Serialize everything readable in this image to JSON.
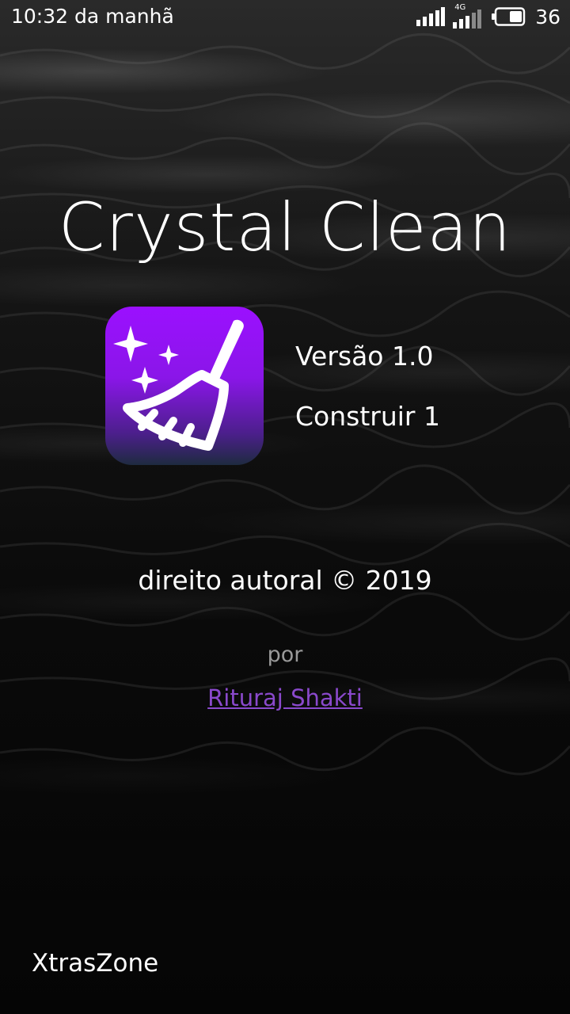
{
  "status_bar": {
    "time": "10:32 da manhã",
    "network_label": "4G",
    "battery_level": "36",
    "icons": [
      "signal-icon",
      "signal-4g-icon",
      "battery-icon"
    ]
  },
  "app": {
    "title": "Crystal Clean",
    "icon": "broom-sparkle-icon",
    "version": "Versão 1.0",
    "build": "Construir 1"
  },
  "credits": {
    "copyright": "direito autoral © 2019",
    "by_label": "por",
    "author": "Rituraj Shakti"
  },
  "footer": {
    "brand": "XtrasZone"
  },
  "colors": {
    "accent_link": "#8a49cc",
    "icon_gradient_top": "#9b10ff",
    "icon_gradient_bottom": "#1e2b40"
  }
}
